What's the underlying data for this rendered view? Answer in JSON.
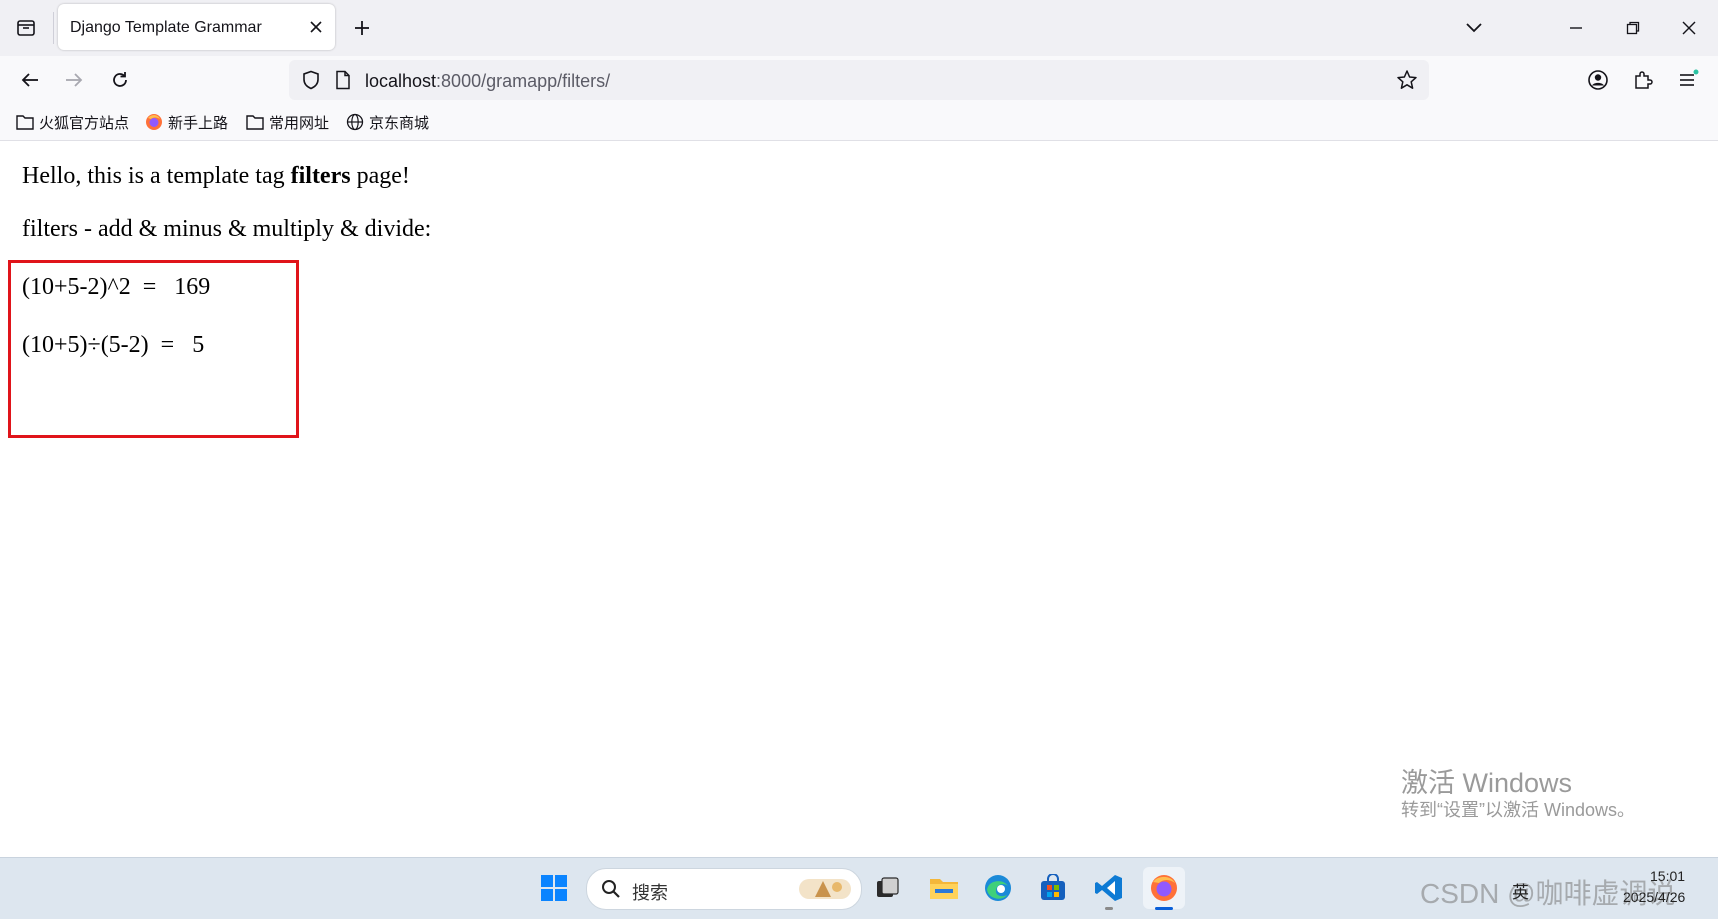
{
  "browser": {
    "tab": {
      "title": "Django Template Grammar"
    },
    "url": {
      "host": "localhost",
      "rest": ":8000/gramapp/filters/"
    },
    "bookmarks": [
      {
        "label": "火狐官方站点",
        "icon": "folder-icon"
      },
      {
        "label": "新手上路",
        "icon": "firefox-icon"
      },
      {
        "label": "常用网址",
        "icon": "folder-icon"
      },
      {
        "label": "京东商城",
        "icon": "globe-icon"
      }
    ]
  },
  "page": {
    "intro": "Hello, this is a template tag ",
    "intro_bold": "filters",
    "intro_end": " page!",
    "subtitle": "filters - add & minus & multiply & divide:",
    "line1": "(10+5-2)^2  =   169",
    "line2": "(10+5)÷(5-2)  =   5"
  },
  "watermark": {
    "title": "激活 Windows",
    "subtitle": "转到“设置”以激活 Windows。"
  },
  "taskbar": {
    "search_placeholder": "搜索",
    "tray_lang": "英",
    "time": "15:01",
    "date": "2025/4/26",
    "csdn_watermark": "CSDN @咖啡虚调说"
  },
  "colors": {
    "highlight_border": "#e0141a",
    "accent_blue": "#0a84ff",
    "firefox_orange": "#ff7139"
  }
}
